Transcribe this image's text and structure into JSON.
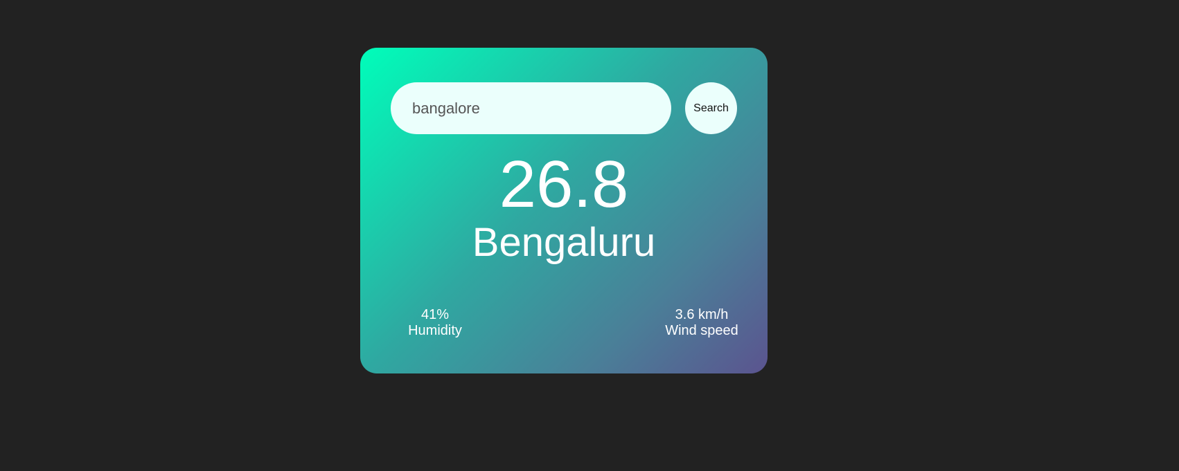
{
  "search": {
    "value": "bangalore",
    "button_label": "Search"
  },
  "weather": {
    "temperature": "26.8",
    "city": "Bengaluru",
    "humidity_value": "41%",
    "humidity_label": "Humidity",
    "wind_value": "3.6 km/h",
    "wind_label": "Wind speed"
  },
  "colors": {
    "background": "#222222",
    "card_gradient_start": "#00feba",
    "card_gradient_end": "#5b548f",
    "input_background": "#ebfffc"
  }
}
